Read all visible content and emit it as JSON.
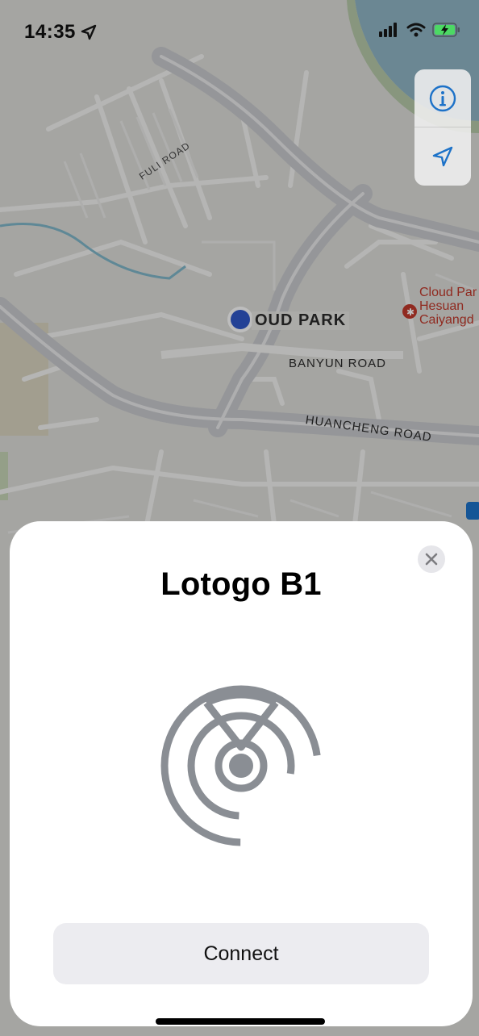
{
  "status_bar": {
    "time": "14:35"
  },
  "map": {
    "labels": {
      "fuli_road": "FULI ROAD",
      "park": "OUD PARK",
      "banyun_road": "BANYUN ROAD",
      "huancheng_road": "HUANCHENG ROAD"
    },
    "poi": {
      "line1": "Cloud Par",
      "line2": "Hesuan",
      "line3": "Caiyangd"
    },
    "controls": {
      "info_icon": "info-icon",
      "location_icon": "location-arrow-icon"
    }
  },
  "sheet": {
    "title": "Lotogo B1",
    "connect_label": "Connect",
    "device_icon": "beacon-radar-icon",
    "close_icon": "close-icon"
  },
  "colors": {
    "accent": "#1d72c8",
    "icon_gray": "#8a8e94",
    "user_dot": "#2f57c8",
    "poi_red": "#c0392b"
  }
}
